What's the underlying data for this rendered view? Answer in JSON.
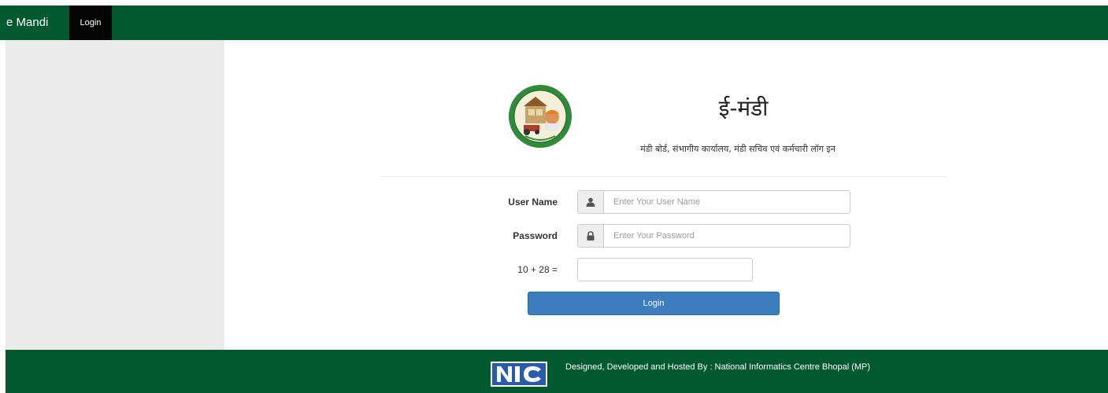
{
  "navbar": {
    "brand": "e Mandi",
    "login_link": "Login",
    "background_color": "#01592f"
  },
  "header": {
    "logo_icon": "mandi-board-emblem",
    "title": "ई-मंडी",
    "subtitle": "मंडी बोर्ड, संभागीय कार्यालय, मंडी सचिव एवं कर्मचारी लॉग इन"
  },
  "form": {
    "username": {
      "label": "User Name",
      "placeholder": "Enter Your User Name",
      "value": "",
      "icon": "user-icon"
    },
    "password": {
      "label": "Password",
      "placeholder": "Enter Your Password",
      "value": "",
      "icon": "lock-icon"
    },
    "captcha": {
      "question": "10 + 28 =",
      "value": ""
    },
    "submit_label": "Login",
    "submit_color": "#3b7dbd"
  },
  "footer": {
    "logo_icon": "nic-logo",
    "text": "Designed, Developed and Hosted By : National Informatics Centre Bhopal (MP)"
  }
}
